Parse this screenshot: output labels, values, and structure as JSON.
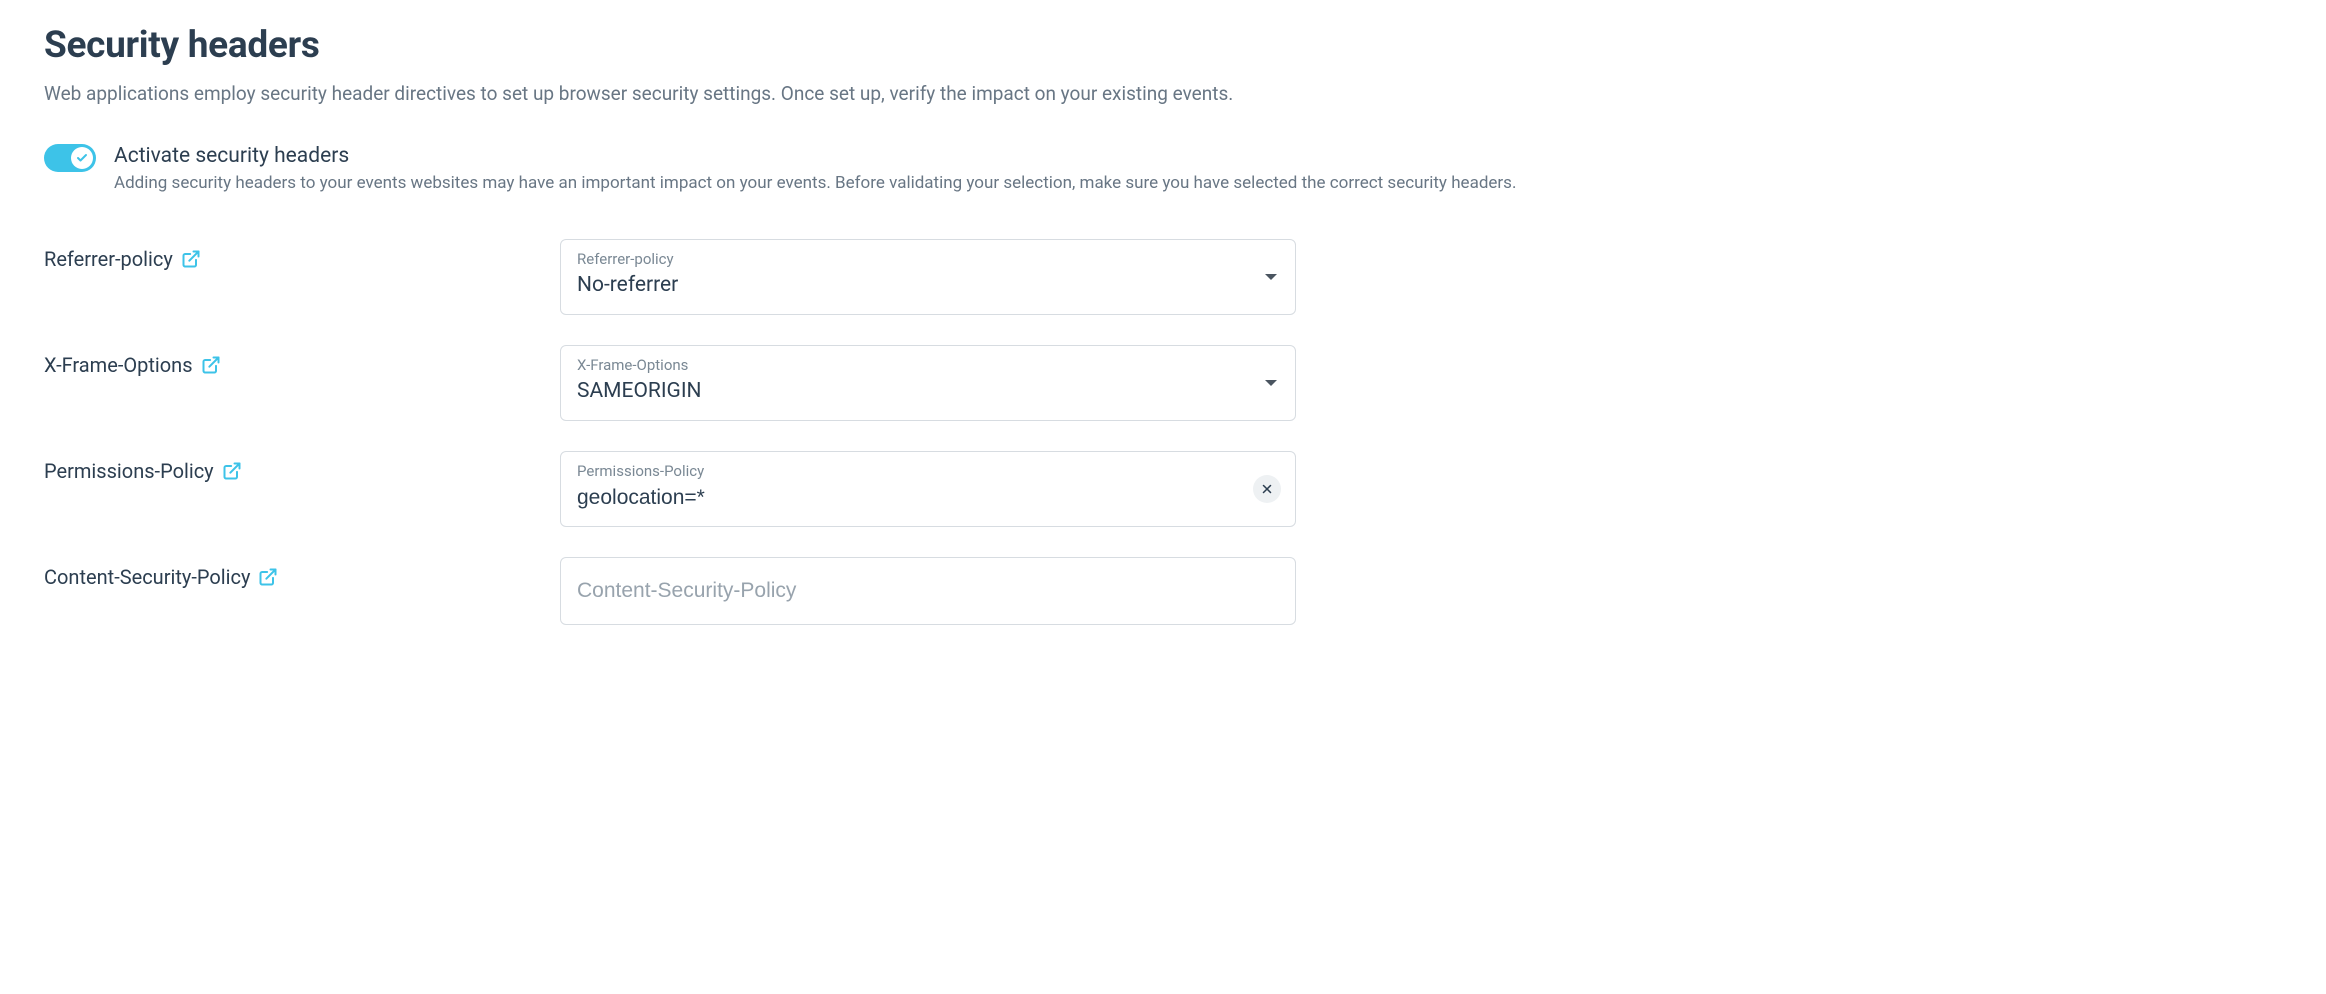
{
  "page": {
    "title": "Security headers",
    "description": "Web applications employ security header directives to set up browser security settings. Once set up, verify the impact on your existing events."
  },
  "toggle": {
    "title": "Activate security headers",
    "subtitle": "Adding security headers to your events websites may have an important impact on your events. Before validating your selection, make sure you have selected the correct security headers."
  },
  "fields": {
    "referrer": {
      "label": "Referrer-policy",
      "floating_label": "Referrer-policy",
      "value": "No-referrer"
    },
    "xframe": {
      "label": "X-Frame-Options",
      "floating_label": "X-Frame-Options",
      "value": "SAMEORIGIN"
    },
    "permissions": {
      "label": "Permissions-Policy",
      "floating_label": "Permissions-Policy",
      "value": "geolocation=*"
    },
    "csp": {
      "label": "Content-Security-Policy",
      "placeholder": "Content-Security-Policy",
      "value": ""
    }
  }
}
